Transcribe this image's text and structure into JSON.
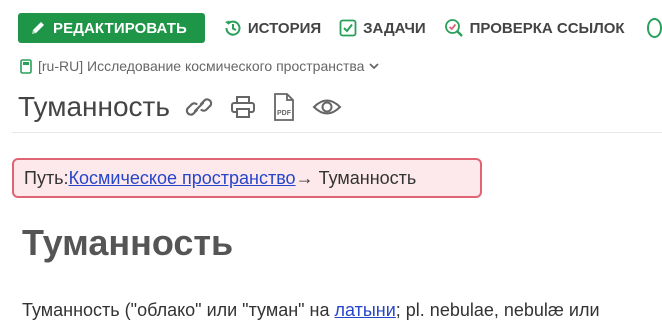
{
  "toolbar": {
    "edit_label": "РЕДАКТИРОВАТЬ",
    "history_label": "ИСТОРИЯ",
    "tasks_label": "ЗАДАЧИ",
    "check_links_label": "ПРОВЕРКА ССЫЛОК"
  },
  "book": {
    "label": "[ru-RU] Исследование космического пространства"
  },
  "page": {
    "title": "Туманность",
    "actions": [
      "link-icon",
      "print-icon",
      "pdf-icon",
      "eye-icon"
    ]
  },
  "path": {
    "prefix": "Путь: ",
    "link": "Космическое пространство",
    "arrow_current": "→ Туманность"
  },
  "article": {
    "heading": "Туманность",
    "para_start": "Туманность (\"облако\" или \"туман\" на ",
    "para_link": "латыни",
    "para_end": "; pl. nebulae, nebulæ или"
  },
  "colors": {
    "edit_bg": "#1f9647",
    "accent_green": "#2aa05a",
    "link": "#2645c9",
    "path_border": "#e06473",
    "path_bg": "#fde9ec"
  }
}
